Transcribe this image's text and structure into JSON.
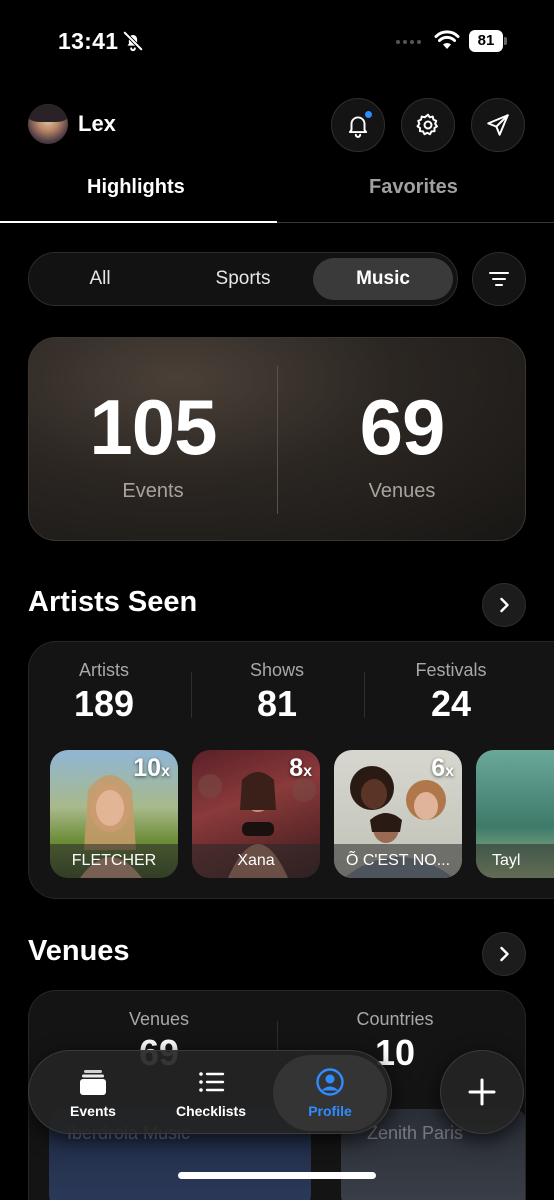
{
  "status_bar": {
    "time": "13:41",
    "battery": "81"
  },
  "header": {
    "user_name": "Lex"
  },
  "main_tabs": [
    {
      "label": "Highlights",
      "active": true
    },
    {
      "label": "Favorites",
      "active": false
    }
  ],
  "segments": [
    {
      "label": "All",
      "active": false
    },
    {
      "label": "Sports",
      "active": false
    },
    {
      "label": "Music",
      "active": true
    }
  ],
  "summary": {
    "events_value": "105",
    "events_label": "Events",
    "venues_value": "69",
    "venues_label": "Venues"
  },
  "artists_section": {
    "title": "Artists Seen",
    "stats": [
      {
        "label": "Artists",
        "value": "189"
      },
      {
        "label": "Shows",
        "value": "81"
      },
      {
        "label": "Festivals",
        "value": "24"
      }
    ],
    "artists": [
      {
        "name": "FLETCHER",
        "count": "10",
        "suffix": "x"
      },
      {
        "name": "Xana",
        "count": "8",
        "suffix": "x"
      },
      {
        "name": "Õ C'EST NO...",
        "count": "6",
        "suffix": "x"
      },
      {
        "name": "Tayl",
        "count": "",
        "suffix": ""
      }
    ]
  },
  "venues_section": {
    "title": "Venues",
    "stats": [
      {
        "label": "Venues",
        "value": "69"
      },
      {
        "label": "Countries",
        "value": "10"
      }
    ],
    "photos": [
      {
        "label": "Iberdrola Music"
      },
      {
        "label": "Zenith Paris"
      }
    ]
  },
  "bottom_nav": [
    {
      "label": "Events",
      "icon": "events-stack-icon",
      "active": false
    },
    {
      "label": "Checklists",
      "icon": "list-icon",
      "active": false
    },
    {
      "label": "Profile",
      "icon": "person-circle-icon",
      "active": true
    }
  ],
  "colors": {
    "accent": "#2f8cff",
    "background": "#000000"
  }
}
